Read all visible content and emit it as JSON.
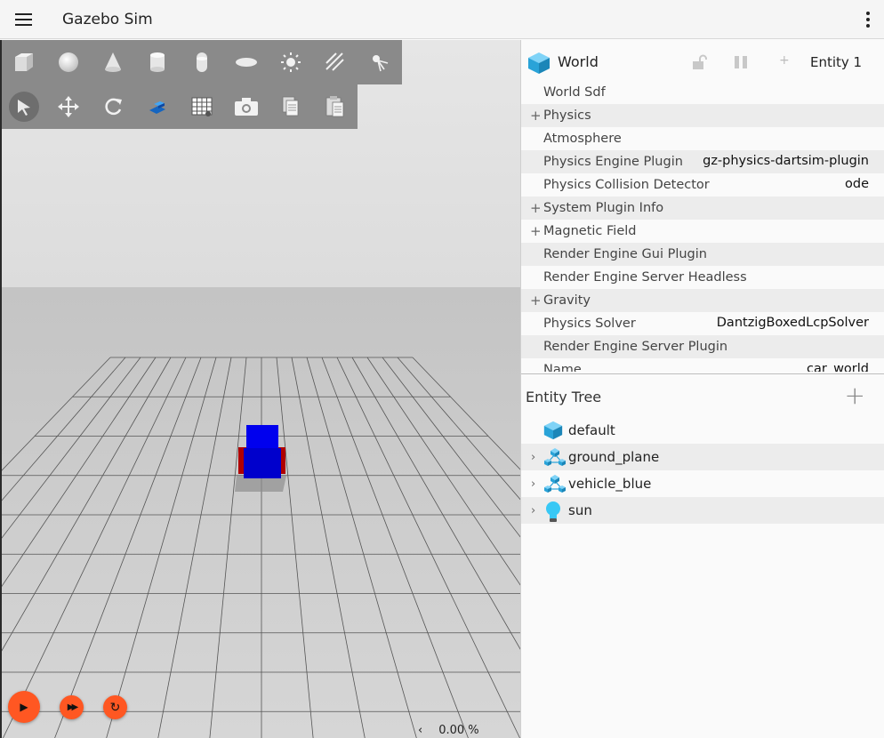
{
  "app": {
    "title": "Gazebo Sim"
  },
  "toolbar_shapes": [
    "box",
    "sphere",
    "cone",
    "cylinder",
    "capsule",
    "ellipsoid",
    "sun",
    "directional-light",
    "spot-light"
  ],
  "toolbar_transform": [
    "select",
    "translate",
    "rotate",
    "snap",
    "grid",
    "screenshot",
    "copy",
    "paste"
  ],
  "component_header": {
    "title": "World",
    "entity_label": "Entity 1"
  },
  "components": [
    {
      "label": "World Sdf",
      "value": "",
      "expandable": false
    },
    {
      "label": "Physics",
      "value": "",
      "expandable": true
    },
    {
      "label": "Atmosphere",
      "value": "",
      "expandable": false
    },
    {
      "label": "Physics Engine Plugin",
      "value": "gz-physics-dartsim-plugin",
      "expandable": false
    },
    {
      "label": "Physics Collision Detector",
      "value": "ode",
      "expandable": false
    },
    {
      "label": "System Plugin Info",
      "value": "",
      "expandable": true
    },
    {
      "label": "Magnetic Field",
      "value": "",
      "expandable": true
    },
    {
      "label": "Render Engine Gui Plugin",
      "value": "",
      "expandable": false
    },
    {
      "label": "Render Engine Server Headless",
      "value": "",
      "expandable": false
    },
    {
      "label": "Gravity",
      "value": "",
      "expandable": true
    },
    {
      "label": "Physics Solver",
      "value": "DantzigBoxedLcpSolver",
      "expandable": false
    },
    {
      "label": "Render Engine Server Plugin",
      "value": "",
      "expandable": false
    },
    {
      "label": "Name",
      "value": "car_world",
      "expandable": false
    }
  ],
  "entity_tree": {
    "title": "Entity Tree",
    "items": [
      {
        "label": "default",
        "icon": "world-icon",
        "expandable": false
      },
      {
        "label": "ground_plane",
        "icon": "model-icon",
        "expandable": true
      },
      {
        "label": "vehicle_blue",
        "icon": "model-icon",
        "expandable": true
      },
      {
        "label": "sun",
        "icon": "light-icon",
        "expandable": true
      }
    ]
  },
  "playback": {
    "play": "▶",
    "step": "▶▶",
    "reset": "↻",
    "rtf_arrow": "‹",
    "rtf": "0.00 %"
  },
  "colors": {
    "accent": "#ff5722",
    "toolbar": "#8a8a8a",
    "vehicle_body": "#0000ff",
    "vehicle_wheels": "#cc0000",
    "world_icon": "#29a3d8"
  }
}
